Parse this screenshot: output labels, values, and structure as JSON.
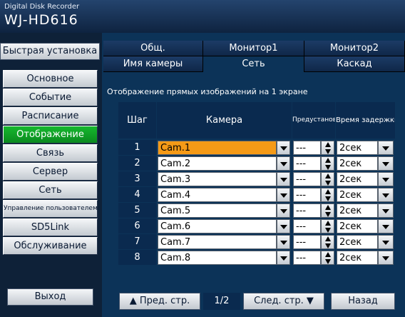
{
  "device": {
    "subtitle": "Digital Disk Recorder",
    "model": "WJ-HD616"
  },
  "quick_setup": "Быстрая установка",
  "menu": [
    {
      "label": "Основное"
    },
    {
      "label": "Событие"
    },
    {
      "label": "Расписание"
    },
    {
      "label": "Отображение"
    },
    {
      "label": "Связь"
    },
    {
      "label": "Сервер"
    },
    {
      "label": "Сеть"
    },
    {
      "label": "Управление пользователем"
    },
    {
      "label": "SD5Link"
    },
    {
      "label": "Обслуживание"
    }
  ],
  "selected_menu": "Отображение",
  "exit_label": "Выход",
  "tabs_row1": [
    {
      "label": "Общ."
    },
    {
      "label": "Монитор1"
    },
    {
      "label": "Монитор2"
    }
  ],
  "tabs_row2": [
    {
      "label": "Имя камеры"
    },
    {
      "label": "Сеть"
    },
    {
      "label": "Каскад"
    }
  ],
  "selected_tab": "Сеть",
  "page_title": "Отображение прямых изображений на 1 экране",
  "table": {
    "headers": {
      "step": "Шаг",
      "camera": "Камера",
      "preset": "Предустановка",
      "delay": "Время задержки"
    },
    "rows": [
      {
        "step": "1",
        "camera": "Cam.1",
        "preset": "---",
        "delay": "2сек"
      },
      {
        "step": "2",
        "camera": "Cam.2",
        "preset": "---",
        "delay": "2сек"
      },
      {
        "step": "3",
        "camera": "Cam.3",
        "preset": "---",
        "delay": "2сек"
      },
      {
        "step": "4",
        "camera": "Cam.4",
        "preset": "---",
        "delay": "2сек"
      },
      {
        "step": "5",
        "camera": "Cam.5",
        "preset": "---",
        "delay": "2сек"
      },
      {
        "step": "6",
        "camera": "Cam.6",
        "preset": "---",
        "delay": "2сек"
      },
      {
        "step": "7",
        "camera": "Cam.7",
        "preset": "---",
        "delay": "2сек"
      },
      {
        "step": "8",
        "camera": "Cam.8",
        "preset": "---",
        "delay": "2сек"
      }
    ]
  },
  "pagination": {
    "prev": "▲ Пред. стр.",
    "page": "1/2",
    "next": "След. стр. ▼"
  },
  "back_label": "Назад",
  "colors": {
    "selected_menu": "#16b82e",
    "selected_field": "#f59a17",
    "panel": "#0c3358"
  }
}
